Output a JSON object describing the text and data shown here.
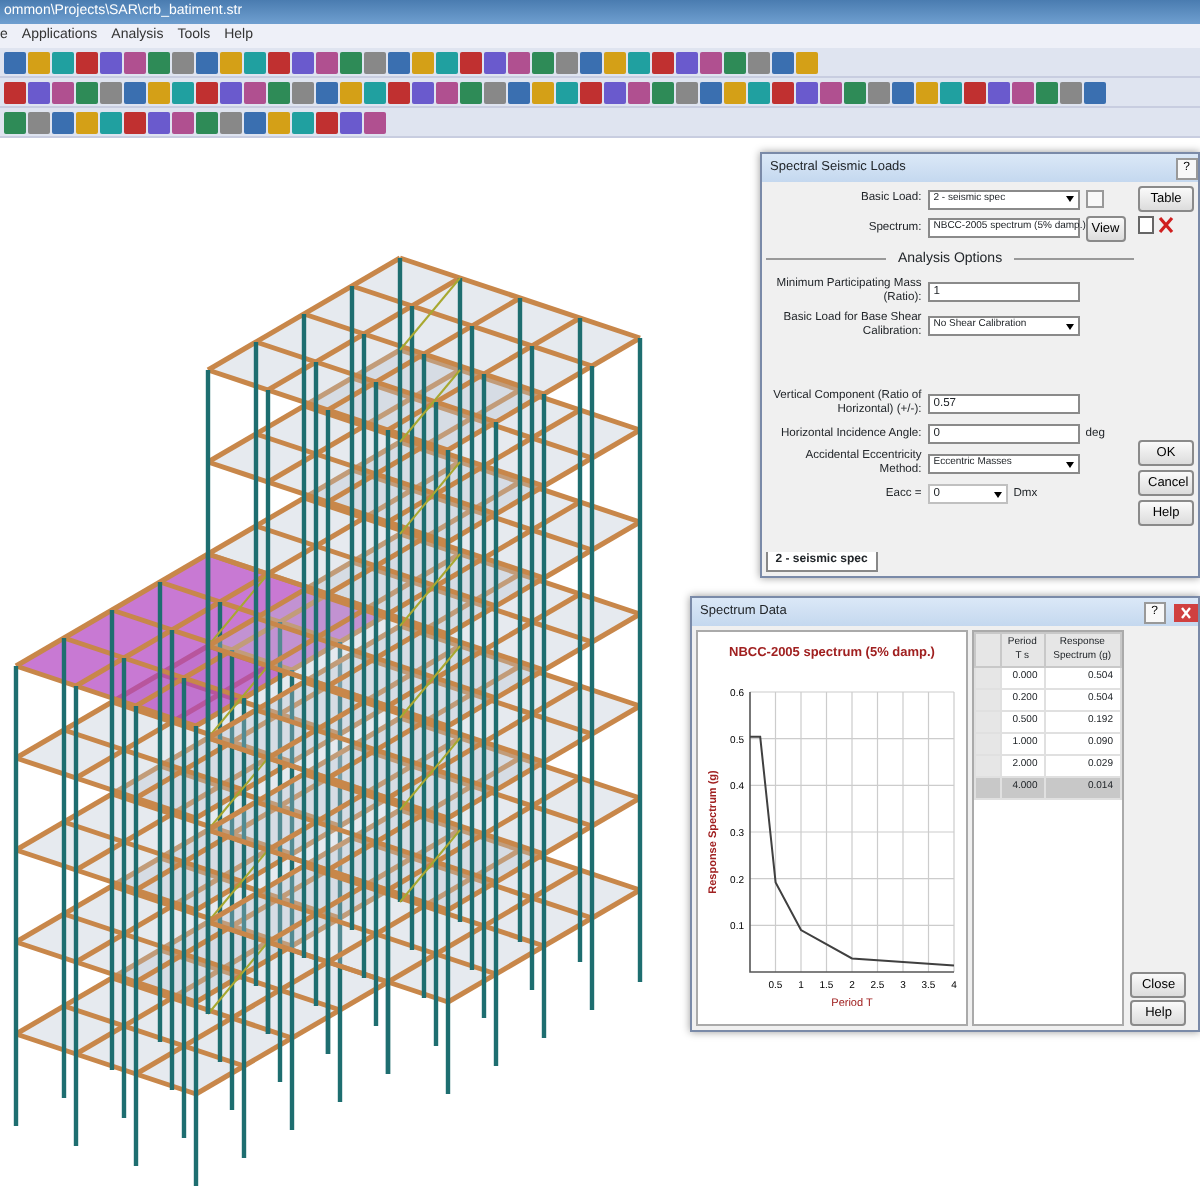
{
  "window": {
    "title": "ommon\\Projects\\SAR\\crb_batiment.str"
  },
  "menu": [
    "e",
    "Applications",
    "Analysis",
    "Tools",
    "Help"
  ],
  "spectral_seismic_loads": {
    "title": "Spectral Seismic Loads",
    "help_glyph": "?",
    "fields": [
      {
        "kind": "select",
        "label": "Basic Load:",
        "value": "2 - seismic spec",
        "edit_icon": true
      },
      {
        "kind": "select",
        "label": "Spectrum:",
        "value": "NBCC-2005 spectrum (5% damp.)",
        "button_label": "View"
      },
      {
        "kind": "section",
        "label": "Analysis Options"
      },
      {
        "kind": "input",
        "label": "Minimum Participating Mass (Ratio):",
        "value": "1"
      },
      {
        "kind": "select",
        "label": "Basic Load for Base Shear Calibration:",
        "value": "No Shear Calibration"
      },
      {
        "kind": "gap"
      },
      {
        "kind": "input",
        "label": "Vertical Component (Ratio of Horizontal) (+/-):",
        "value": "0.57"
      },
      {
        "kind": "input",
        "label": "Horizontal Incidence Angle:",
        "value": "0",
        "unit": "deg"
      },
      {
        "kind": "select",
        "label": "Accidental Eccentricity Method:",
        "value": "Eccentric Masses"
      },
      {
        "kind": "combo",
        "label": "Eacc =",
        "value": "0",
        "unit": "Dmx"
      }
    ],
    "tabs": [
      {
        "label": "2 - seismic spec",
        "selected": true
      }
    ],
    "table_button": "Table",
    "buttons": [
      "OK",
      "Cancel",
      "Help"
    ]
  },
  "spectrum_data": {
    "title": "Spectrum Data",
    "help_glyph": "?",
    "chart_data": {
      "type": "line",
      "title": "NBCC-2005 spectrum (5% damp.)",
      "xlabel": "Period T",
      "ylabel": "Response Spectrum (g)",
      "x": [
        0,
        0.2,
        0.5,
        1,
        2,
        4
      ],
      "series": [
        {
          "color": "#404040",
          "values": [
            0.504,
            0.504,
            0.192,
            0.09,
            0.029,
            0.014
          ]
        }
      ],
      "grid": true,
      "xlim": [
        0,
        4
      ],
      "ylim": [
        0,
        0.6
      ],
      "xticks": [
        {
          "value": 0.5,
          "label": "0.5"
        },
        {
          "value": 1,
          "label": "1"
        },
        {
          "value": 1.5,
          "label": "1.5"
        },
        {
          "value": 2,
          "label": "2"
        },
        {
          "value": 2.5,
          "label": "2.5"
        },
        {
          "value": 3,
          "label": "3"
        },
        {
          "value": 3.5,
          "label": "3.5"
        },
        {
          "value": 4,
          "label": "4"
        }
      ],
      "yticks": [
        {
          "value": 0.1,
          "label": "0.1"
        },
        {
          "value": 0.2,
          "label": "0.2"
        },
        {
          "value": 0.3,
          "label": "0.3"
        },
        {
          "value": 0.4,
          "label": "0.4"
        },
        {
          "value": 0.5,
          "label": "0.5"
        },
        {
          "value": 0.6,
          "label": "0.6"
        }
      ]
    },
    "table": {
      "columns": [
        "Period T s",
        "Response Spectrum (g)"
      ],
      "rows": [
        {
          "period": "0.000",
          "response": "0.504",
          "selected": false
        },
        {
          "period": "0.200",
          "response": "0.504",
          "selected": false
        },
        {
          "period": "0.500",
          "response": "0.192",
          "selected": false
        },
        {
          "period": "1.000",
          "response": "0.090",
          "selected": false
        },
        {
          "period": "2.000",
          "response": "0.029",
          "selected": false
        },
        {
          "period": "4.000",
          "response": "0.014",
          "selected": true
        }
      ]
    },
    "buttons": [
      "Close",
      "Help"
    ]
  }
}
